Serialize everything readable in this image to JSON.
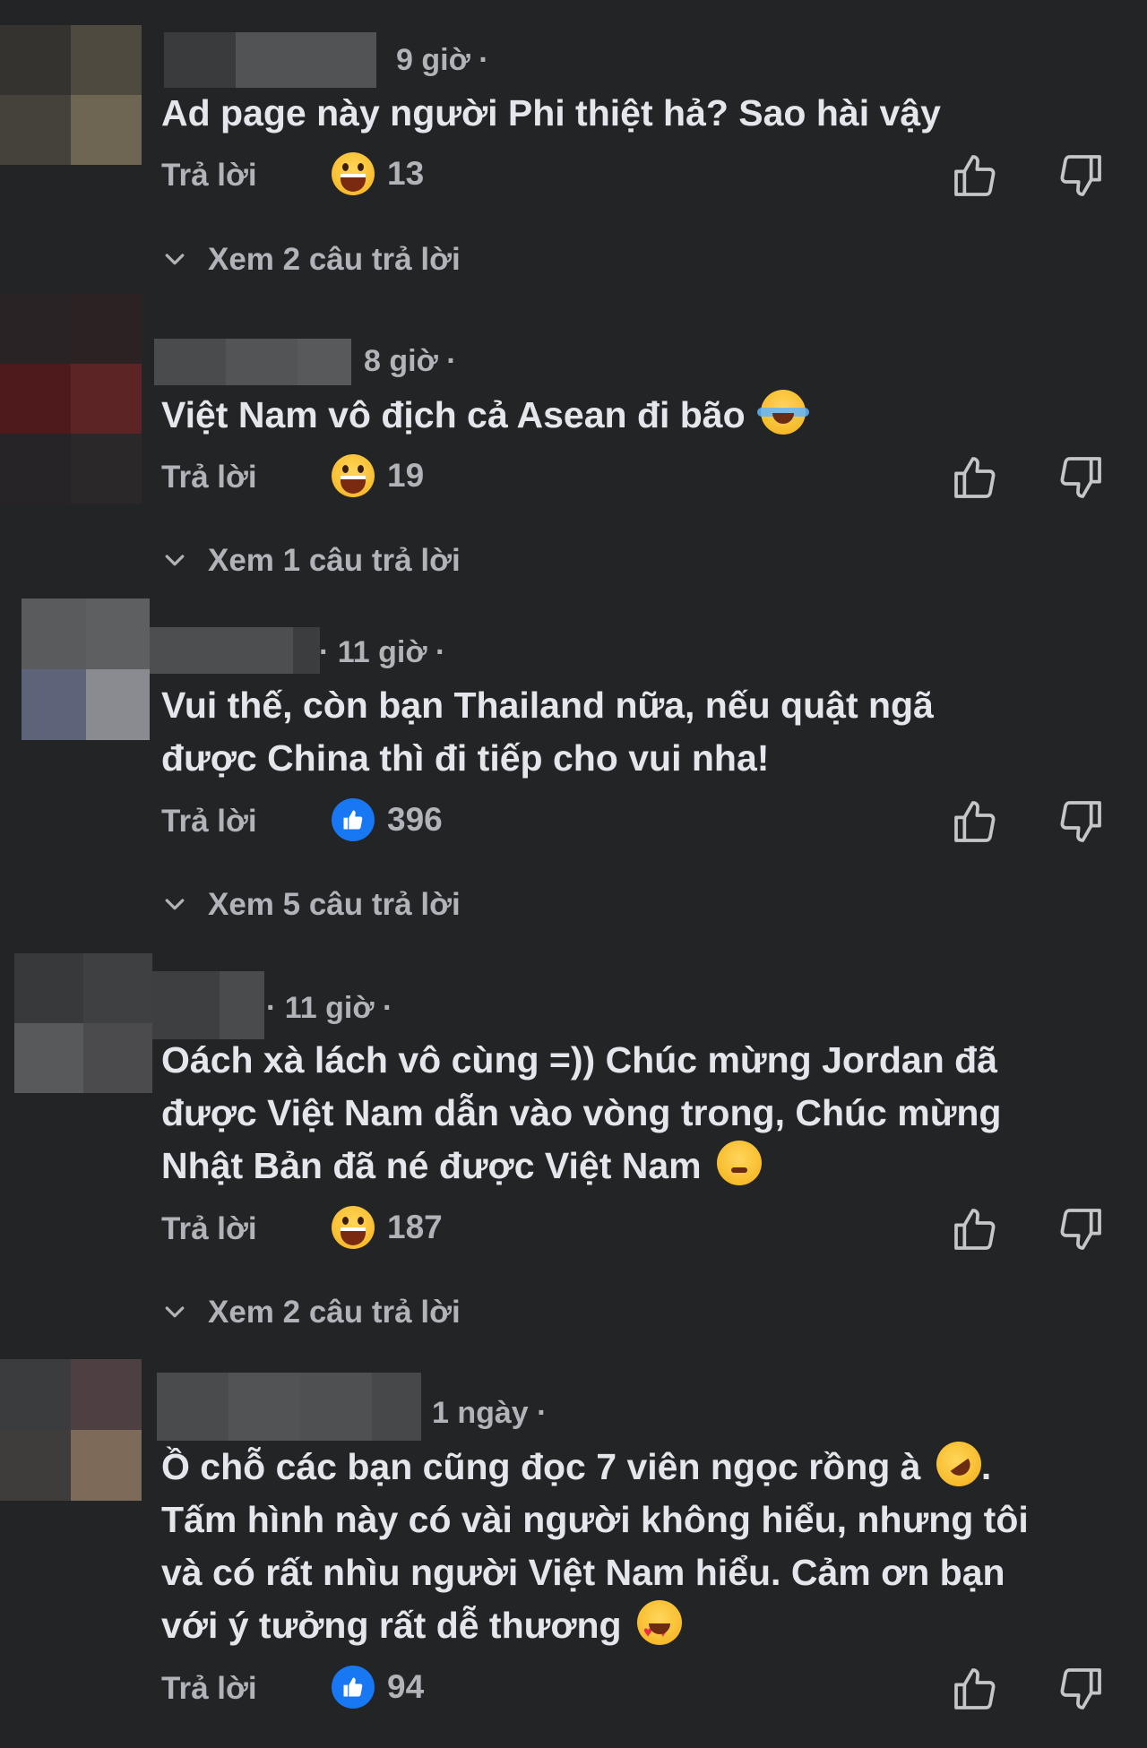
{
  "reply_label": "Trả lời",
  "comments": [
    {
      "time": "9 giờ ·",
      "lines": [
        "Ad page này người Phi thiệt hả? Sao hài vậy"
      ],
      "reaction_icon": "grinning-emoji-icon",
      "reaction_count": "13",
      "replies_label": "Xem 2 câu trả lời"
    },
    {
      "time": "8 giờ ·",
      "lines": [
        "Việt Nam vô địch cả Asean đi bão"
      ],
      "reaction_icon": "grinning-emoji-icon",
      "reaction_count": "19",
      "replies_label": "Xem 1 câu trả lời"
    },
    {
      "time": "· 11 giờ ·",
      "lines": [
        "Vui thế, còn bạn Thailand nữa, nếu quật ngã",
        "được China thì đi tiếp cho vui nha!"
      ],
      "reaction_icon": "like-reaction-icon",
      "reaction_count": "396",
      "replies_label": "Xem 5 câu trả lời"
    },
    {
      "time": "· 11 giờ ·",
      "lines": [
        "Oách xà lách vô cùng =)) Chúc mừng Jordan đã",
        "được Việt Nam dẫn vào vòng trong, Chúc mừng",
        "Nhật Bản đã né được Việt Nam"
      ],
      "reaction_icon": "grinning-emoji-icon",
      "reaction_count": "187",
      "replies_label": "Xem 2 câu trả lời"
    },
    {
      "time": "1 ngày ·",
      "lines": [
        "Ồ chỗ các bạn cũng đọc 7 viên ngọc rồng à",
        "Tấm hình này có vài người không hiểu, nhưng tôi",
        "và có rất nhìu người Việt Nam hiểu. Cảm ơn bạn",
        "với ý tưởng rất dễ thương"
      ],
      "reaction_icon": "like-reaction-icon",
      "reaction_count": "94"
    }
  ]
}
